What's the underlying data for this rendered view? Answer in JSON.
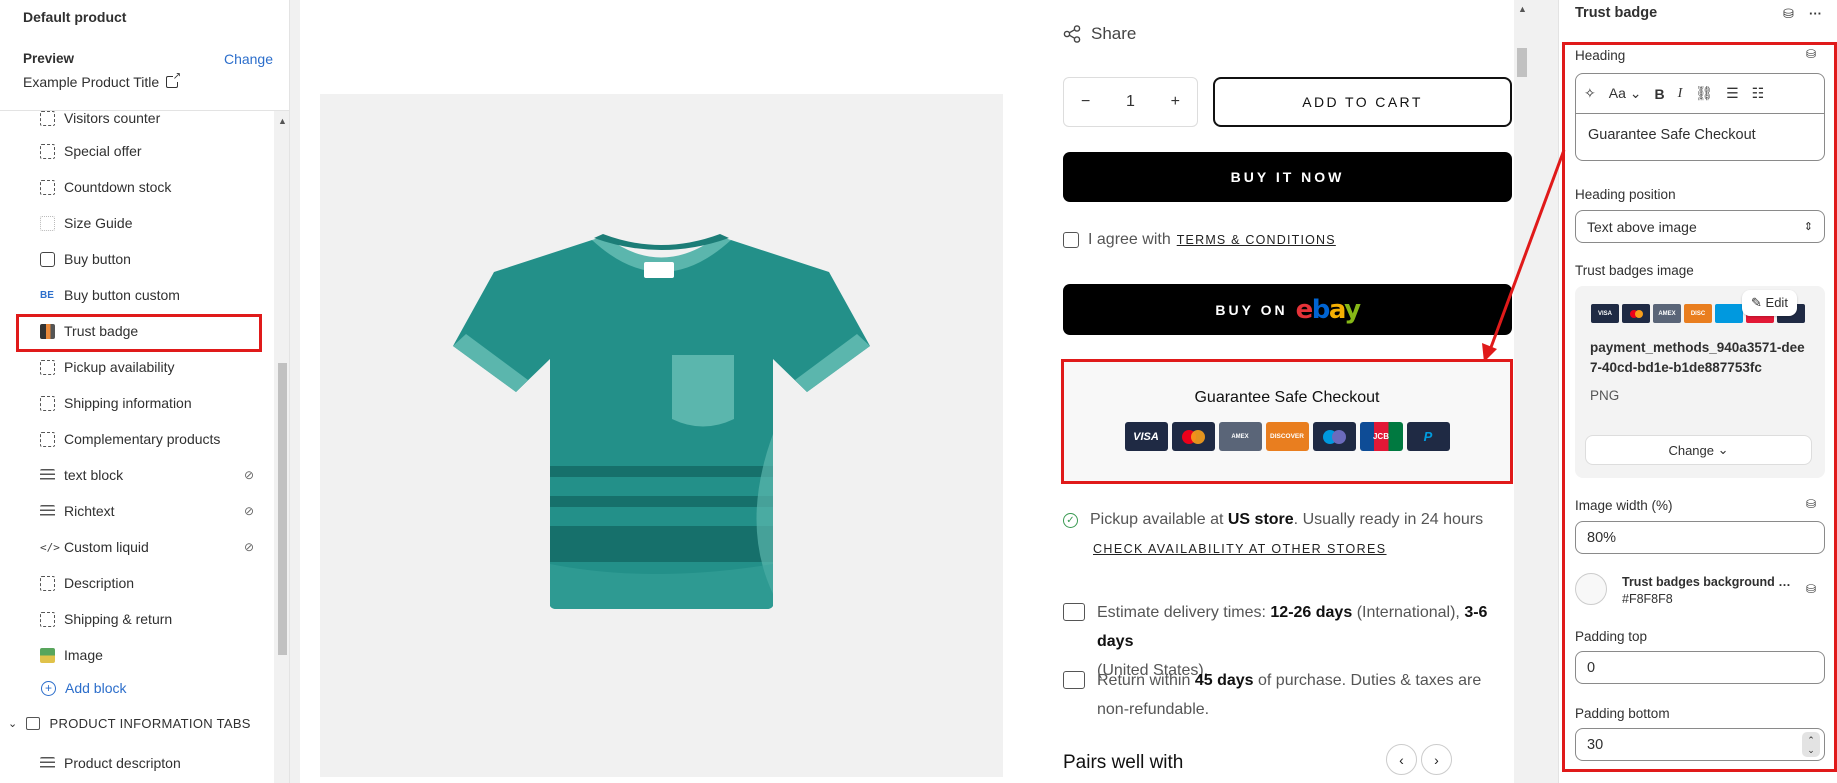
{
  "left": {
    "title": "Default product",
    "preview_label": "Preview",
    "change_label": "Change",
    "product_title": "Example Product Title",
    "blocks": [
      {
        "label": "Visitors counter",
        "icon": "dashed-square-icon"
      },
      {
        "label": "Special offer",
        "icon": "dashed-square-icon"
      },
      {
        "label": "Countdown stock",
        "icon": "dashed-square-icon"
      },
      {
        "label": "Size Guide",
        "icon": "size-guide-icon"
      },
      {
        "label": "Buy button",
        "icon": "cursor-button-icon"
      },
      {
        "label": "Buy button custom",
        "icon": "bbc-icon"
      },
      {
        "label": "Trust badge",
        "icon": "trust-badge-image-icon"
      },
      {
        "label": "Pickup availability",
        "icon": "dashed-square-icon"
      },
      {
        "label": "Shipping information",
        "icon": "dashed-square-icon"
      },
      {
        "label": "Complementary products",
        "icon": "dashed-square-icon"
      },
      {
        "label": "text block",
        "icon": "text-lines-icon",
        "hidden": true
      },
      {
        "label": "Richtext",
        "icon": "text-lines-icon",
        "hidden": true
      },
      {
        "label": "Custom liquid",
        "icon": "code-icon",
        "hidden": true
      },
      {
        "label": "Description",
        "icon": "dashed-square-icon"
      },
      {
        "label": "Shipping & return",
        "icon": "dashed-square-icon"
      },
      {
        "label": "Image",
        "icon": "image-icon"
      }
    ],
    "add_block": "Add block",
    "section": "PRODUCT INFORMATION TABS",
    "product_description": "Product descripton"
  },
  "preview": {
    "share": "Share",
    "quantity": "1",
    "add_to_cart": "ADD TO CART",
    "buy_it_now": "BUY IT NOW",
    "agree_text": "I agree with",
    "terms": "TERMS & CONDITIONS",
    "buy_on": "BUY ON",
    "ebay": [
      "e",
      "b",
      "a",
      "y"
    ],
    "trust_heading": "Guarantee Safe Checkout",
    "cards": [
      "VISA",
      "MC",
      "AMEX",
      "DISCOVER",
      "MAESTRO",
      "DINERS",
      "JCB",
      "PAYPAL"
    ],
    "pickup_pre": "Pickup available at",
    "pickup_store": "US store",
    "pickup_post": ". Usually ready in 24 hours",
    "check_availability": "CHECK AVAILABILITY AT OTHER STORES",
    "delivery_pre": "Estimate delivery times:",
    "delivery_intl": "12-26 days",
    "delivery_intl_label": "(International),",
    "delivery_us": "3-6 days",
    "delivery_us_label": "(United States).",
    "return_pre": "Return within",
    "return_days": "45 days",
    "return_post": "of purchase. Duties & taxes are non-refundable.",
    "pairs": "Pairs well with"
  },
  "settings": {
    "title": "Trust badge",
    "heading_label": "Heading",
    "heading_value": "Guarantee Safe Checkout",
    "heading_position_label": "Heading position",
    "heading_position_value": "Text above image",
    "image_label": "Trust badges image",
    "edit_label": "Edit",
    "file_name": "payment_methods_940a3571-dee7-40cd-bd1e-b1de887753fc",
    "file_type": "PNG",
    "change_label": "Change",
    "image_width_label": "Image width (%)",
    "image_width_value": "80%",
    "bg_color_label": "Trust badges background c...",
    "bg_color_value": "#F8F8F8",
    "padding_top_label": "Padding top",
    "padding_top_value": "0",
    "padding_bottom_label": "Padding bottom",
    "padding_bottom_value": "30"
  },
  "colors": {
    "highlight": "#e01a1a",
    "link": "#2c6ecb",
    "tshirt": "#239089",
    "button": "#000000"
  }
}
